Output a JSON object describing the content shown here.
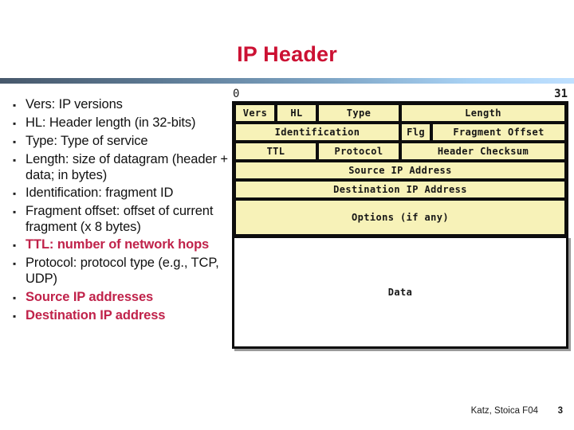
{
  "slide": {
    "title": "IP Header",
    "title_color": "#CC1133",
    "divider_gradient_from": "#47586b",
    "divider_gradient_to": "#bfe0ff"
  },
  "bullets": {
    "marker": "▪",
    "items": [
      {
        "text": "Vers: IP versions",
        "highlight": false
      },
      {
        "text": "HL: Header length (in 32-bits)",
        "highlight": false
      },
      {
        "text": "Type: Type of service",
        "highlight": false
      },
      {
        "text": "Length: size of datagram (header + data; in bytes)",
        "highlight": false
      },
      {
        "text": "Identification: fragment ID",
        "highlight": false
      },
      {
        "text": "Fragment offset: offset of current fragment (x 8 bytes)",
        "highlight": false
      },
      {
        "text": "TTL: number of network hops",
        "highlight": true
      },
      {
        "text": "Protocol: protocol type (e.g., TCP, UDP)",
        "highlight": false
      },
      {
        "text": "Source IP addresses",
        "highlight": true
      },
      {
        "text": "Destination IP address",
        "highlight": true
      }
    ],
    "highlight_color": "#C0224A"
  },
  "diagram": {
    "bit_start_label": "0",
    "bit_end_label": "31",
    "field_fill_color": "#f7f2b8",
    "rows": [
      {
        "cells": [
          {
            "label": "Vers",
            "width_pct": 12.5
          },
          {
            "label": "HL",
            "width_pct": 12.5
          },
          {
            "label": "Type",
            "width_pct": 25
          },
          {
            "label": "Length",
            "width_pct": 50
          }
        ]
      },
      {
        "cells": [
          {
            "label": "Identification",
            "width_pct": 50
          },
          {
            "label": "Flg",
            "width_pct": 9.4
          },
          {
            "label": "Fragment Offset",
            "width_pct": 40.6
          }
        ]
      },
      {
        "cells": [
          {
            "label": "TTL",
            "width_pct": 25
          },
          {
            "label": "Protocol",
            "width_pct": 25
          },
          {
            "label": "Header Checksum",
            "width_pct": 50
          }
        ]
      },
      {
        "cells": [
          {
            "label": "Source IP Address",
            "width_pct": 100
          }
        ]
      },
      {
        "cells": [
          {
            "label": "Destination IP Address",
            "width_pct": 100
          }
        ]
      },
      {
        "cells": [
          {
            "label": "Options (if any)",
            "width_pct": 100,
            "tall": true
          }
        ]
      }
    ],
    "payload_label": "Data"
  },
  "footer": {
    "credit": "Katz, Stoica F04",
    "slide_number": "3"
  }
}
